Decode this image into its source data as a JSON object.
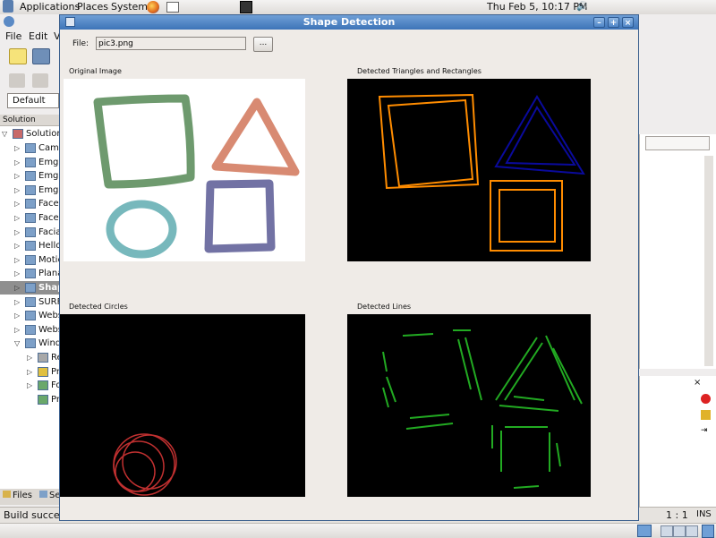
{
  "top_panel": {
    "menus": [
      "Applications",
      "Places",
      "System"
    ],
    "clock": "Thu Feb  5, 10:17 PM"
  },
  "ide": {
    "menu": [
      "File",
      "Edit",
      "V"
    ],
    "config_select": "Default",
    "solution_header": "Solution",
    "solution_root": "Solution",
    "tree_items": [
      "Came",
      "Emgu",
      "Emgu",
      "Emgu",
      "Face",
      "Face",
      "Facia",
      "Hello",
      "Motic",
      "Plana",
      "Shap",
      "SURF",
      "Webs",
      "Webs",
      "Windo",
      "Re",
      "Pr",
      "Fo",
      "Pr"
    ],
    "bottom_tabs": [
      "Files",
      "Se"
    ],
    "status_text": "Build success",
    "cursor_position": "1 : 1",
    "insert_mode": "INS"
  },
  "dialog": {
    "title": "Shape Detection",
    "file_label": "File:",
    "file_value": "pic3.png",
    "browse_label": "...",
    "panels": {
      "original": "Original Image",
      "triangles_rects": "Detected Triangles and  Rectangles",
      "circles": "Detected Circles",
      "lines": "Detected Lines"
    }
  },
  "colors": {
    "title_bar": "#3d74b8",
    "rect_detect": "#ff8c00",
    "tri_detect": "#00008b",
    "circle_detect": "#c03030",
    "line_detect": "#22aa22"
  }
}
